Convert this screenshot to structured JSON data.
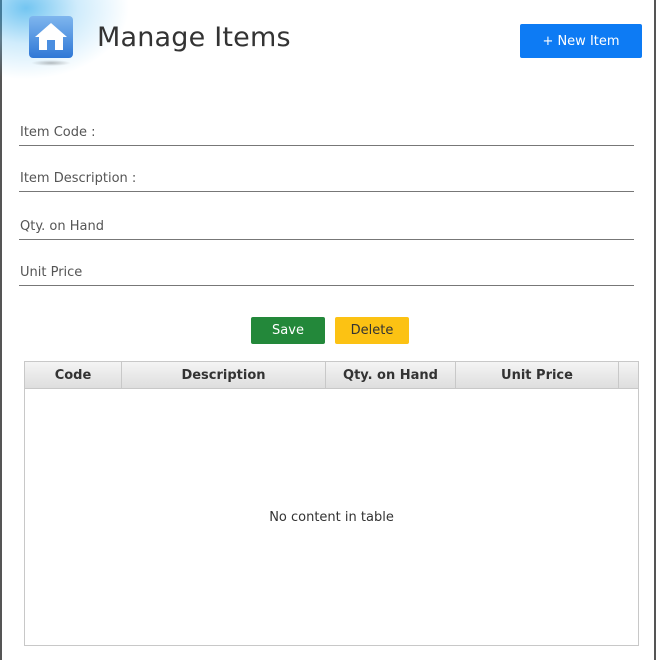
{
  "header": {
    "title": "Manage Items",
    "new_button_label": "+ New Item"
  },
  "form": {
    "item_code_placeholder": "Item Code :",
    "item_description_placeholder": "Item Description :",
    "qty_on_hand_placeholder": "Qty. on Hand",
    "unit_price_placeholder": "Unit Price",
    "item_code_value": "",
    "item_description_value": "",
    "qty_on_hand_value": "",
    "unit_price_value": ""
  },
  "actions": {
    "save_label": "Save",
    "delete_label": "Delete"
  },
  "table": {
    "columns": [
      "Code",
      "Description",
      "Qty. on Hand",
      "Unit Price"
    ],
    "rows": [],
    "empty_text": "No content in table"
  },
  "icons": {
    "home": "home-icon"
  },
  "colors": {
    "primary": "#0d7bf4",
    "save": "#23883a",
    "delete": "#fcc213"
  }
}
